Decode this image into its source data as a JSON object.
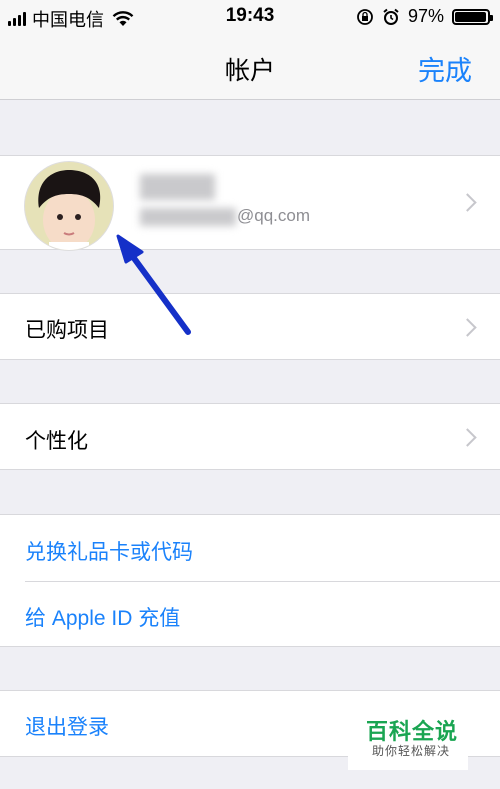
{
  "status_bar": {
    "carrier": "中国电信",
    "time": "19:43",
    "battery": "97%",
    "battery_level": 0.97
  },
  "nav": {
    "title": "帐户",
    "done_label": "完成"
  },
  "profile": {
    "email_suffix": "@qq.com"
  },
  "menu": {
    "purchased": "已购项目",
    "personalize": "个性化",
    "redeem": "兑换礼品卡或代码",
    "add_funds": "给 Apple ID 充值",
    "sign_out": "退出登录"
  },
  "watermark": {
    "title": "百科全说",
    "subtitle": "助你轻松解决"
  },
  "colors": {
    "accent": "#1a82fb",
    "arrow": "#1530c8",
    "background": "#efeff4",
    "watermark_green": "#1aa552"
  }
}
